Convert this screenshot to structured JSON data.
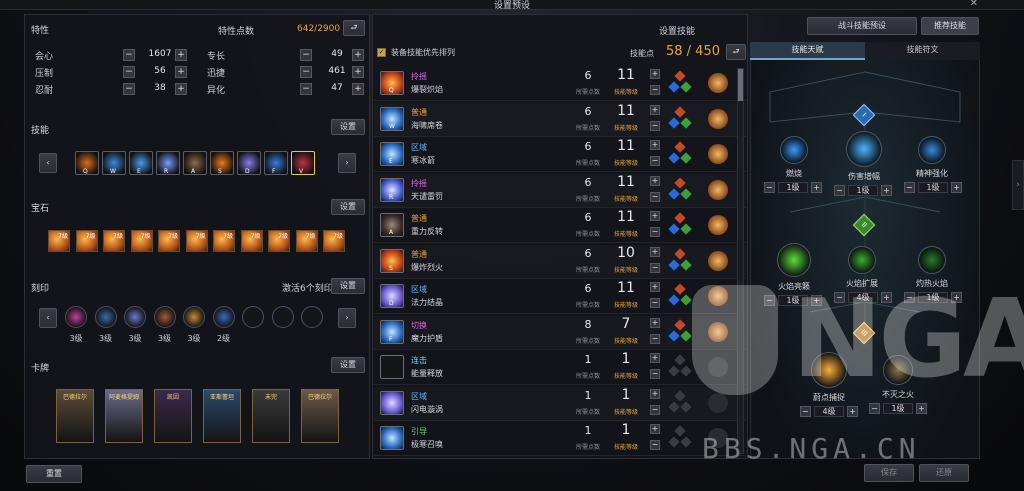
{
  "window": {
    "title": "设置预设",
    "close": "✕"
  },
  "left": {
    "stats": {
      "title": "特性",
      "points_label": "特性点数",
      "points_value": "642/2900",
      "items": [
        {
          "name": "会心",
          "value": "1607"
        },
        {
          "name": "压制",
          "value": "56"
        },
        {
          "name": "忍耐",
          "value": "38"
        },
        {
          "name": "专长",
          "value": "49"
        },
        {
          "name": "迅捷",
          "value": "461"
        },
        {
          "name": "异化",
          "value": "47"
        }
      ]
    },
    "skills": {
      "title": "技能",
      "settings": "设置",
      "keys": [
        "Q",
        "W",
        "E",
        "R",
        "A",
        "S",
        "D",
        "F",
        "V"
      ]
    },
    "gems": {
      "title": "宝石",
      "settings": "设置",
      "levels": [
        "7级",
        "7级",
        "7级",
        "7级",
        "7级",
        "7级",
        "7级",
        "7级",
        "7级",
        "7级",
        "7级"
      ]
    },
    "engravings": {
      "title": "刻印",
      "activate_text": "激活6个刻印",
      "settings": "设置",
      "levels": [
        "3级",
        "3级",
        "3级",
        "3级",
        "3级",
        "2级"
      ]
    },
    "cards": {
      "title": "卡牌",
      "settings": "设置",
      "names": [
        "巴德拉尔",
        "阿麦格提姆",
        "凯因",
        "亚斯蕾坦",
        "未完",
        "巴德拉尔"
      ]
    },
    "reset": "重置"
  },
  "middle": {
    "title": "设置技能",
    "sort_label": "装备技能优先排列",
    "points_label": "技能点",
    "points_value": "58 / 450",
    "skill_points_caption": "所需点数",
    "skill_level_caption": "技能等级",
    "skills": [
      {
        "type": "拎摇",
        "type_color": "#d86adf",
        "name": "爆裂炽焰",
        "key": "Q",
        "points": "6",
        "level": "11",
        "icon": "fire"
      },
      {
        "type": "普通",
        "type_color": "#e9a33a",
        "name": "海啸席卷",
        "key": "W",
        "points": "6",
        "level": "11",
        "icon": "ice"
      },
      {
        "type": "区域",
        "type_color": "#5fb6ff",
        "name": "寒冰箭",
        "key": "E",
        "points": "6",
        "level": "11",
        "icon": "ice"
      },
      {
        "type": "拎摇",
        "type_color": "#d86adf",
        "name": "天谴雷罚",
        "key": "R",
        "points": "6",
        "level": "11",
        "icon": "lightning"
      },
      {
        "type": "普通",
        "type_color": "#e9a33a",
        "name": "重力反转",
        "key": "A",
        "points": "6",
        "level": "11",
        "icon": "dark"
      },
      {
        "type": "普通",
        "type_color": "#e9a33a",
        "name": "爆炸烈火",
        "key": "S",
        "points": "6",
        "level": "10",
        "icon": "fire"
      },
      {
        "type": "区域",
        "type_color": "#5fb6ff",
        "name": "法力结晶",
        "key": "D",
        "points": "6",
        "level": "11",
        "icon": "arcane"
      },
      {
        "type": "切换",
        "type_color": "#d86adf",
        "name": "魔力护盾",
        "key": "F",
        "points": "8",
        "level": "7",
        "icon": "ice"
      },
      {
        "type": "连击",
        "type_color": "#5fd6ff",
        "name": "能量释放",
        "key": "",
        "points": "1",
        "level": "1",
        "icon": "none"
      },
      {
        "type": "区域",
        "type_color": "#5fb6ff",
        "name": "闪电漩涡",
        "key": "",
        "points": "1",
        "level": "1",
        "icon": "arcane"
      },
      {
        "type": "引导",
        "type_color": "#6fd66f",
        "name": "极寒召唤",
        "key": "",
        "points": "1",
        "level": "1",
        "icon": "ice"
      }
    ]
  },
  "right": {
    "tabs": [
      "战斗技能预设",
      "推荐技能"
    ],
    "subtabs": [
      "技能天赋",
      "技能符文"
    ],
    "tree": {
      "row1": [
        {
          "name": "燃烧",
          "level": "1级"
        },
        {
          "name": "伤害增幅",
          "level": "1级"
        },
        {
          "name": "精神强化",
          "level": "1级"
        }
      ],
      "row2": [
        {
          "name": "火焰亮籁",
          "level": "1级"
        },
        {
          "name": "火焰扩展",
          "level": "4级"
        },
        {
          "name": "灼热火焰",
          "level": "1级"
        }
      ],
      "row3": [
        {
          "name": "蔚点捕捉",
          "level": "4级"
        },
        {
          "name": "不灭之火",
          "level": "1级"
        }
      ],
      "tier_marks": [
        "I",
        "II",
        "III"
      ]
    },
    "save": "保存",
    "restore": "还原"
  },
  "watermark": {
    "logo": "NGA",
    "url": "BBS.NGA.CN"
  }
}
